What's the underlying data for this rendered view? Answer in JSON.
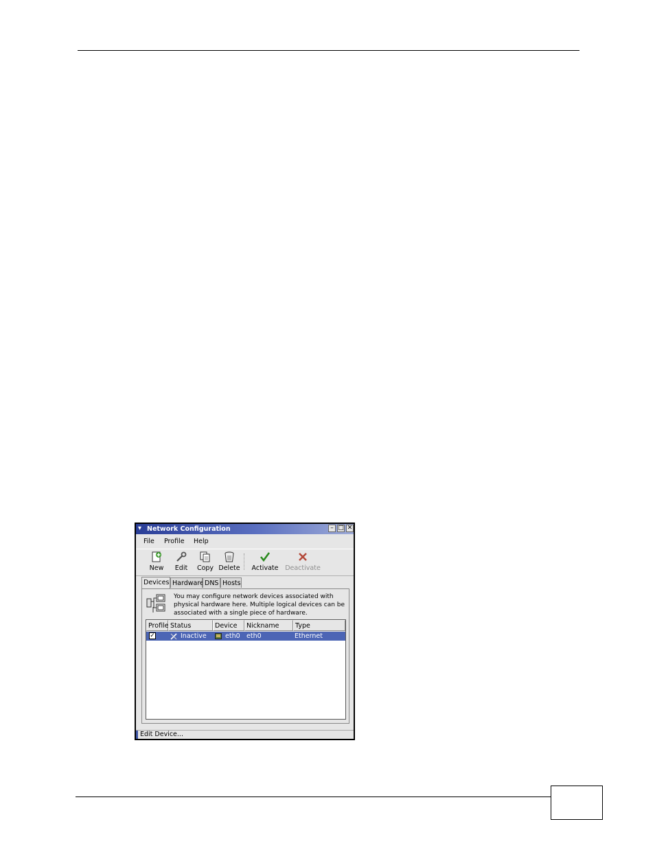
{
  "window": {
    "title": "Network Configuration"
  },
  "menu": [
    "File",
    "Profile",
    "Help"
  ],
  "toolbar": [
    {
      "label": "New",
      "icon": "new-icon",
      "enabled": true
    },
    {
      "label": "Edit",
      "icon": "wrench-icon",
      "enabled": true
    },
    {
      "label": "Copy",
      "icon": "copy-icon",
      "enabled": true
    },
    {
      "label": "Delete",
      "icon": "trash-icon",
      "enabled": true
    },
    {
      "label": "Activate",
      "icon": "checkmark-icon",
      "enabled": true
    },
    {
      "label": "Deactivate",
      "icon": "x-icon",
      "enabled": false
    }
  ],
  "tabs": [
    "Devices",
    "Hardware",
    "DNS",
    "Hosts"
  ],
  "active_tab": "Devices",
  "info": "You may configure network devices associated with physical hardware here.  Multiple logical devices can be associated with a single piece of hardware.",
  "table": {
    "columns": [
      "Profile",
      "Status",
      "Device",
      "Nickname",
      "Type"
    ],
    "rows": [
      {
        "profile_checked": true,
        "status": "Inactive",
        "device": "eth0",
        "nickname": "eth0",
        "type": "Ethernet"
      }
    ]
  },
  "status": "Edit Device...",
  "colors": {
    "titlebar": "#2a3e97",
    "selection": "#4c65b5",
    "window_bg": "#e6e6e6"
  }
}
